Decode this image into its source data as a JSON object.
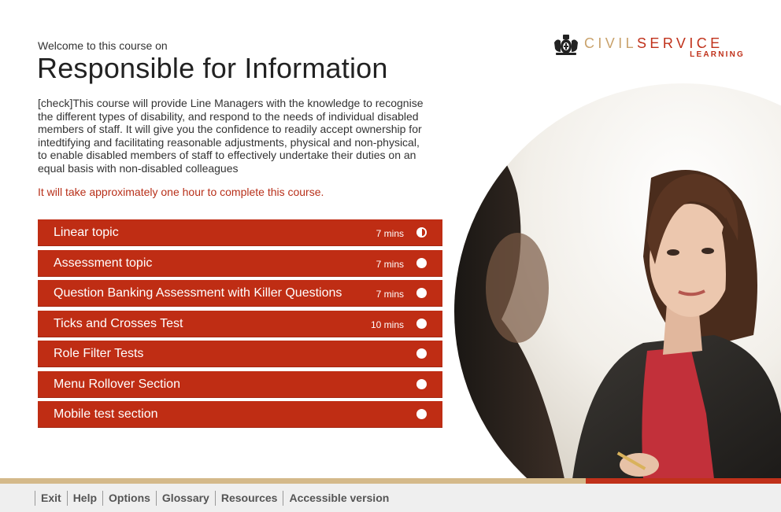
{
  "header": {
    "welcome": "Welcome to this course on",
    "title": "Responsible for Information",
    "description": "[check]This course will provide Line Managers with the knowledge to recognise the different types of disability, and respond to the needs of individual disabled members of staff. It will give you the confidence to readily accept ownership for intedtifying and facilitating reasonable adjustments, physical and non-physical, to enable disabled members of staff to effectively undertake their duties on an equal basis with non-disabled colleagues",
    "duration": "It will take approximately one hour to complete this course."
  },
  "logo": {
    "civil": "CIVIL",
    "service": "SERVICE",
    "learning": "LEARNING"
  },
  "topics": [
    {
      "label": "Linear topic",
      "mins": "7 mins",
      "status": "half"
    },
    {
      "label": "Assessment topic",
      "mins": "7 mins",
      "status": "empty"
    },
    {
      "label": "Question Banking Assessment with Killer Questions",
      "mins": "7 mins",
      "status": "empty"
    },
    {
      "label": "Ticks and Crosses Test",
      "mins": "10 mins",
      "status": "empty"
    },
    {
      "label": "Role Filter Tests",
      "mins": "",
      "status": "empty"
    },
    {
      "label": "Menu Rollover Section",
      "mins": "",
      "status": "empty"
    },
    {
      "label": "Mobile test section",
      "mins": "",
      "status": "empty"
    }
  ],
  "footer": {
    "links": [
      "Exit",
      "Help",
      "Options",
      "Glossary",
      "Resources",
      "Accessible version"
    ]
  },
  "colors": {
    "accent_red": "#bf2d14",
    "gold": "#c9a26b",
    "footer_bg": "#efefef"
  }
}
